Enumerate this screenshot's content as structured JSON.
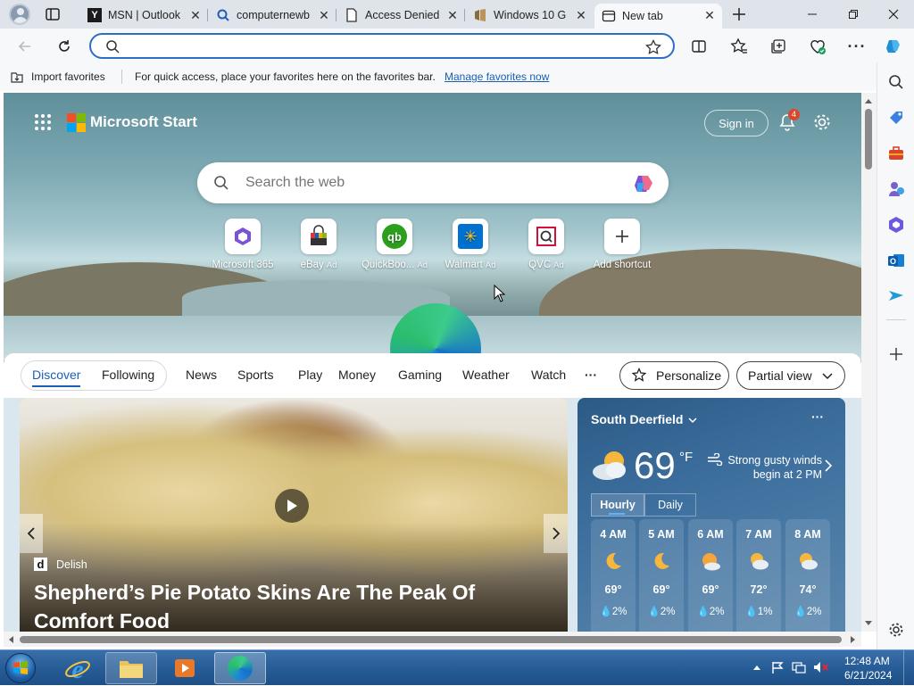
{
  "tabs": [
    {
      "title": "MSN | Outlook",
      "icon": "msn-icon"
    },
    {
      "title": "computernewb",
      "icon": "search-tab-icon"
    },
    {
      "title": "Access Denied",
      "icon": "document-icon"
    },
    {
      "title": "Windows 10 G",
      "icon": "windows-icon"
    },
    {
      "title": "New tab",
      "icon": "new-tab-page-icon"
    }
  ],
  "address": {
    "value": "",
    "placeholder": ""
  },
  "favbar": {
    "import_label": "Import favorites",
    "message": "For quick access, place your favorites here on the favorites bar.",
    "manage_link": "Manage favorites now"
  },
  "msstart": {
    "logo_text": "Microsoft Start",
    "sign_in": "Sign in",
    "notification_count": "4",
    "search_placeholder": "Search the web"
  },
  "quick_links": [
    {
      "label": "Microsoft 365",
      "ad": ""
    },
    {
      "label": "eBay",
      "ad": "Ad"
    },
    {
      "label": "QuickBoo...",
      "ad": "Ad"
    },
    {
      "label": "Walmart",
      "ad": "Ad"
    },
    {
      "label": "QVC",
      "ad": "Ad"
    },
    {
      "label": "Add shortcut",
      "ad": ""
    }
  ],
  "feed": {
    "tabs": [
      "Discover",
      "Following"
    ],
    "categories": [
      "News",
      "Sports",
      "Play",
      "Money",
      "Gaming",
      "Weather",
      "Watch"
    ],
    "more": "···",
    "personalize": "Personalize",
    "view": "Partial view"
  },
  "article": {
    "source": "Delish",
    "source_letter": "d",
    "headline": "Shepherd’s Pie Potato Skins Are The Peak Of Comfort Food"
  },
  "weather": {
    "location": "South Deerfield",
    "temp": "69",
    "unit": "°F",
    "alert": "Strong gusty winds begin at 2 PM",
    "tabs": [
      "Hourly",
      "Daily"
    ],
    "hourly": [
      {
        "time": "4 AM",
        "temp": "69°",
        "precip": "2%",
        "icon": "moon-icon"
      },
      {
        "time": "5 AM",
        "temp": "69°",
        "precip": "2%",
        "icon": "moon-icon"
      },
      {
        "time": "6 AM",
        "temp": "69°",
        "precip": "2%",
        "icon": "sun-cloud-icon"
      },
      {
        "time": "7 AM",
        "temp": "72°",
        "precip": "1%",
        "icon": "partly-cloudy-icon"
      },
      {
        "time": "8 AM",
        "temp": "74°",
        "precip": "2%",
        "icon": "partly-cloudy-icon"
      }
    ]
  },
  "clock": {
    "time": "12:48 AM",
    "date": "6/21/2024"
  },
  "colors": {
    "accent": "#2f6cc4",
    "link": "#1a5fb4",
    "taskbar": "#275d97",
    "weather_card": "#3d6f9e"
  }
}
